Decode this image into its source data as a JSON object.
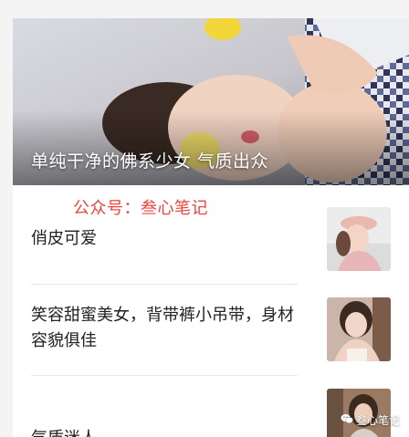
{
  "hero": {
    "title": "单纯干净的佛系少女 气质出众",
    "image_icon": "portrait-photo"
  },
  "overlay": {
    "text": "公众号：叁心笔记",
    "color": "#e8453c"
  },
  "items": [
    {
      "title": "俏皮可爱",
      "thumb_icon": "portrait-photo"
    },
    {
      "title": "笑容甜蜜美女，背带裤小吊带，身材容貌俱佳",
      "thumb_icon": "portrait-photo"
    },
    {
      "title": "气质迷人",
      "thumb_icon": "portrait-photo"
    }
  ],
  "watermark": {
    "text": "叁心笔记",
    "icon": "wechat-icon"
  }
}
